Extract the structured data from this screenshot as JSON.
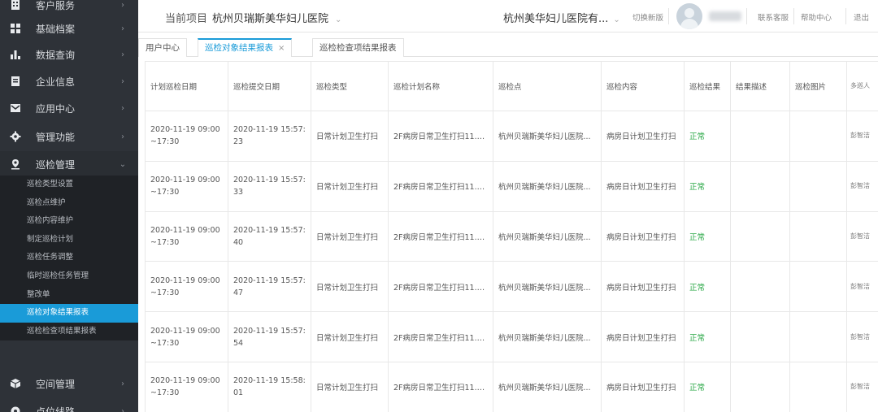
{
  "sidebar": {
    "items": [
      {
        "label": "客户服务",
        "icon": "building-icon"
      },
      {
        "label": "基础档案",
        "icon": "grid-icon"
      },
      {
        "label": "数据查询",
        "icon": "bar-chart-icon"
      },
      {
        "label": "企业信息",
        "icon": "document-icon"
      },
      {
        "label": "应用中心",
        "icon": "mail-icon"
      },
      {
        "label": "管理功能",
        "icon": "gear-icon"
      },
      {
        "label": "巡检管理",
        "icon": "location-pin-icon"
      }
    ],
    "submenu": [
      "巡检类型设置",
      "巡检点维护",
      "巡检内容维护",
      "制定巡检计划",
      "巡检任务调整",
      "临时巡检任务管理",
      "整改单",
      "巡检对象结果报表",
      "巡检检查项结果报表"
    ],
    "bottom_items": [
      {
        "label": "空间管理",
        "icon": "cube-icon"
      },
      {
        "label": "点位线路",
        "icon": "pin-icon"
      }
    ]
  },
  "header": {
    "project_label": "当前项目",
    "project_name": "杭州贝瑞斯美华妇儿医院",
    "org_name": "杭州美华妇儿医院有...",
    "switch_version": "切换新版",
    "contact": "联系客服",
    "help": "帮助中心",
    "logout": "退出"
  },
  "tabs": [
    {
      "label": "用户中心"
    },
    {
      "label": "巡检对象结果报表",
      "close": "×"
    },
    {
      "label": "巡检检查项结果报表"
    }
  ],
  "table": {
    "headers": [
      "计划巡检日期",
      "巡检提交日期",
      "巡检类型",
      "巡检计划名称",
      "巡检点",
      "巡检内容",
      "巡检结果",
      "结果描述",
      "巡检图片",
      "多巡人"
    ],
    "rows": [
      {
        "plan_date": "2020-11-19 09:00~17:30",
        "submit_date": "2020-11-19 15:57:23",
        "type": "日常计划卫生打扫",
        "plan_name": "2F病房日常卫生打扫11.1...",
        "point": "杭州贝瑞斯美华妇儿医院...",
        "content": "病房日计划卫生打扫",
        "result": "正常",
        "desc": "",
        "image": "",
        "person": "彭智洁"
      },
      {
        "plan_date": "2020-11-19 09:00~17:30",
        "submit_date": "2020-11-19 15:57:33",
        "type": "日常计划卫生打扫",
        "plan_name": "2F病房日常卫生打扫11.1...",
        "point": "杭州贝瑞斯美华妇儿医院...",
        "content": "病房日计划卫生打扫",
        "result": "正常",
        "desc": "",
        "image": "",
        "person": "彭智洁"
      },
      {
        "plan_date": "2020-11-19 09:00~17:30",
        "submit_date": "2020-11-19 15:57:40",
        "type": "日常计划卫生打扫",
        "plan_name": "2F病房日常卫生打扫11.1...",
        "point": "杭州贝瑞斯美华妇儿医院...",
        "content": "病房日计划卫生打扫",
        "result": "正常",
        "desc": "",
        "image": "",
        "person": "彭智洁"
      },
      {
        "plan_date": "2020-11-19 09:00~17:30",
        "submit_date": "2020-11-19 15:57:47",
        "type": "日常计划卫生打扫",
        "plan_name": "2F病房日常卫生打扫11.1...",
        "point": "杭州贝瑞斯美华妇儿医院...",
        "content": "病房日计划卫生打扫",
        "result": "正常",
        "desc": "",
        "image": "",
        "person": "彭智洁"
      },
      {
        "plan_date": "2020-11-19 09:00~17:30",
        "submit_date": "2020-11-19 15:57:54",
        "type": "日常计划卫生打扫",
        "plan_name": "2F病房日常卫生打扫11.1...",
        "point": "杭州贝瑞斯美华妇儿医院...",
        "content": "病房日计划卫生打扫",
        "result": "正常",
        "desc": "",
        "image": "",
        "person": "彭智洁"
      },
      {
        "plan_date": "2020-11-19 09:00~17:30",
        "submit_date": "2020-11-19 15:58:01",
        "type": "日常计划卫生打扫",
        "plan_name": "2F病房日常卫生打扫11.1...",
        "point": "杭州贝瑞斯美华妇儿医院...",
        "content": "病房日计划卫生打扫",
        "result": "正常",
        "desc": "",
        "image": "",
        "person": "彭智洁"
      }
    ]
  },
  "colors": {
    "accent": "#1a9bd8",
    "sidebar_bg": "#2e3238",
    "ok": "#28a745"
  }
}
